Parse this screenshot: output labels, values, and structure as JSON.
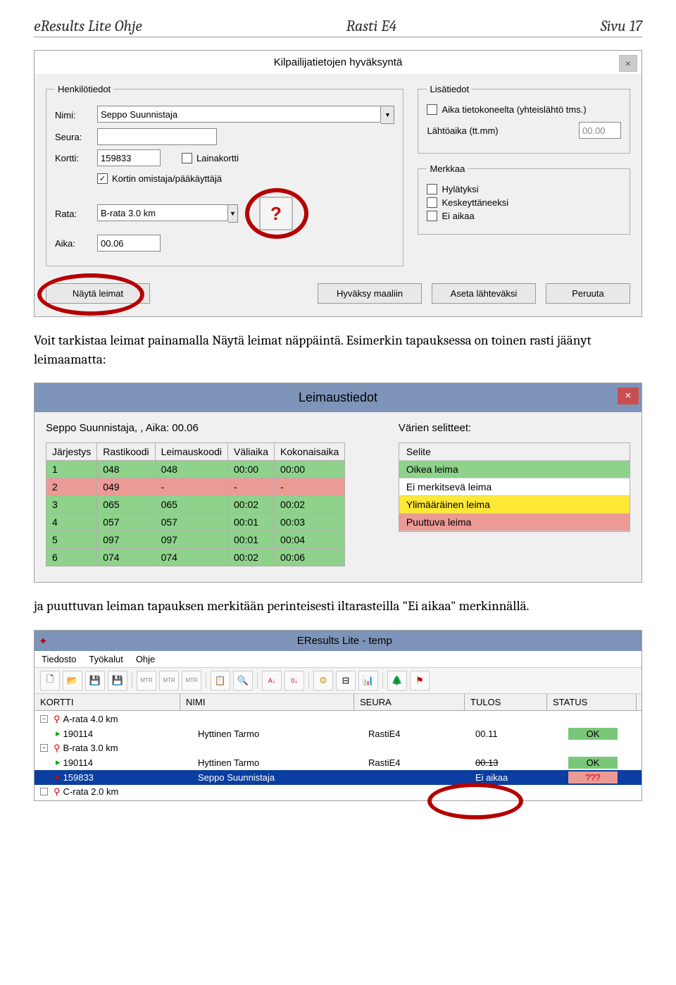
{
  "doc": {
    "left": "eResults Lite Ohje",
    "center": "Rasti E4",
    "right": "Sivu 17"
  },
  "dialog": {
    "title": "Kilpailijatietojen hyväksyntä",
    "groups": {
      "personal": "Henkilötiedot",
      "extra": "Lisätiedot",
      "mark": "Merkkaa"
    },
    "labels": {
      "nimi": "Nimi:",
      "seura": "Seura:",
      "kortti": "Kortti:",
      "rata": "Rata:",
      "aika": "Aika:",
      "lahtoaika": "Lähtöaika (tt.mm)"
    },
    "values": {
      "nimi": "Seppo Suunnistaja",
      "seura": "",
      "kortti": "159833",
      "rata": "B-rata 3.0 km",
      "aika": "00.06",
      "lahto": "00.00"
    },
    "checks": {
      "laina": "Lainakortti",
      "omistaja": "Kortin omistaja/pääkäyttäjä",
      "aikatieto": "Aika tietokoneelta (yhteislähtö tms.)",
      "hyl": "Hylätyksi",
      "kesk": "Keskeyttäneeksi",
      "eia": "Ei aikaa"
    },
    "buttons": {
      "nayta": "Näytä leimat",
      "hyvaksy": "Hyväksy maaliin",
      "aseta": "Aseta lähteväksi",
      "peruuta": "Peruuta"
    },
    "help": "?"
  },
  "para1": "Voit tarkistaa leimat painamalla Näytä leimat näppäintä. Esimerkin tapauksessa on toinen rasti jäänyt leimaamatta:",
  "leim": {
    "title": "Leimaustiedot",
    "info": "Seppo Suunnistaja, ,  Aika: 00.06",
    "legend_title": "Värien selitteet:",
    "headers": [
      "Järjestys",
      "Rastikoodi",
      "Leimauskoodi",
      "Väliaika",
      "Kokonaisaika"
    ],
    "rows": [
      {
        "c": [
          "1",
          "048",
          "048",
          "00:00",
          "00:00"
        ],
        "cls": "row-green"
      },
      {
        "c": [
          "2",
          "049",
          "-",
          "-",
          "-"
        ],
        "cls": "row-red"
      },
      {
        "c": [
          "3",
          "065",
          "065",
          "00:02",
          "00:02"
        ],
        "cls": "row-green"
      },
      {
        "c": [
          "4",
          "057",
          "057",
          "00:01",
          "00:03"
        ],
        "cls": "row-green"
      },
      {
        "c": [
          "5",
          "097",
          "097",
          "00:01",
          "00:04"
        ],
        "cls": "row-green"
      },
      {
        "c": [
          "6",
          "074",
          "074",
          "00:02",
          "00:06"
        ],
        "cls": "row-green"
      }
    ],
    "legend": [
      {
        "t": "Selite",
        "cls": "lg-head"
      },
      {
        "t": "Oikea leima",
        "cls": "lg-green"
      },
      {
        "t": "Ei merkitsevä leima",
        "cls": "lg-white"
      },
      {
        "t": "Ylimääräinen leima",
        "cls": "lg-yellow"
      },
      {
        "t": "Puuttuva leima",
        "cls": "lg-red"
      }
    ]
  },
  "para2": "ja puuttuvan leiman tapauksen merkitään perinteisesti iltarasteilla \"Ei aikaa\" merkinnällä.",
  "main": {
    "title": "EResults Lite - temp",
    "menu": [
      "Tiedosto",
      "Työkalut",
      "Ohje"
    ],
    "cols": [
      "KORTTI",
      "NIMI",
      "SEURA",
      "TULOS",
      "STATUS"
    ],
    "rows": [
      {
        "indent": 0,
        "exp": "-",
        "ico": "course",
        "text": "A-rata 4.0 km"
      },
      {
        "indent": 1,
        "ico": "runner-g",
        "kortti": "190114",
        "nimi": "Hyttinen Tarmo",
        "seura": "RastiE4",
        "tulos": "00.11",
        "status": "OK",
        "scls": "status-ok"
      },
      {
        "indent": 0,
        "exp": "-",
        "ico": "course",
        "text": "B-rata 3.0 km"
      },
      {
        "indent": 1,
        "ico": "runner-g",
        "kortti": "190114",
        "nimi": "Hyttinen Tarmo",
        "seura": "RastiE4",
        "tulos": "00.13",
        "status": "OK",
        "scls": "status-ok",
        "strike": true
      },
      {
        "indent": 1,
        "ico": "runner-r",
        "kortti": "159833",
        "nimi": "Seppo Suunnistaja",
        "seura": "",
        "tulos": "Ei aikaa",
        "status": "???",
        "scls": "status-bad",
        "sel": true
      },
      {
        "indent": 0,
        "exp": " ",
        "ico": "course",
        "text": "C-rata 2.0 km"
      }
    ]
  }
}
